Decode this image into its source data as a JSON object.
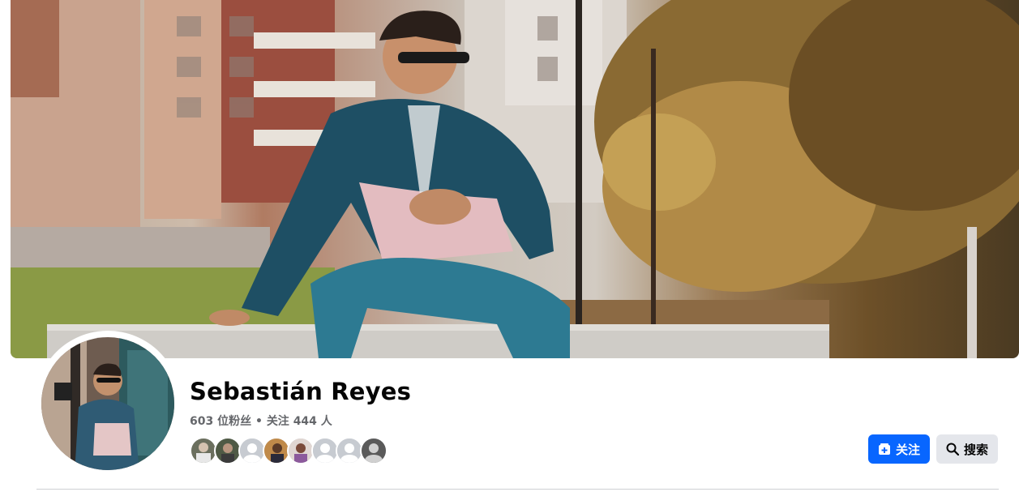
{
  "profile": {
    "name": "Sebastián Reyes",
    "followers_count": "603",
    "followers_label": "位粉丝",
    "separator": "•",
    "following_label": "关注",
    "following_count": "444",
    "following_unit": "人"
  },
  "follower_avatars": [
    {
      "kind": "photo",
      "color": "#6b6f5e"
    },
    {
      "kind": "photo",
      "color": "#4f5a45"
    },
    {
      "kind": "default",
      "color": "#c7cbd1"
    },
    {
      "kind": "photo",
      "color": "#c08a4a"
    },
    {
      "kind": "photo",
      "color": "#7a4a3a"
    },
    {
      "kind": "default",
      "color": "#c7cbd1"
    },
    {
      "kind": "default",
      "color": "#c7cbd1"
    },
    {
      "kind": "photo",
      "color": "#5a5a5a"
    }
  ],
  "actions": {
    "follow_label": "关注",
    "search_label": "搜索"
  },
  "colors": {
    "primary": "#0866ff",
    "secondary_bg": "#e4e6eb",
    "text": "#050505",
    "muted": "#65676b"
  },
  "icons": {
    "follow": "add-friend-icon",
    "search": "search-icon"
  }
}
